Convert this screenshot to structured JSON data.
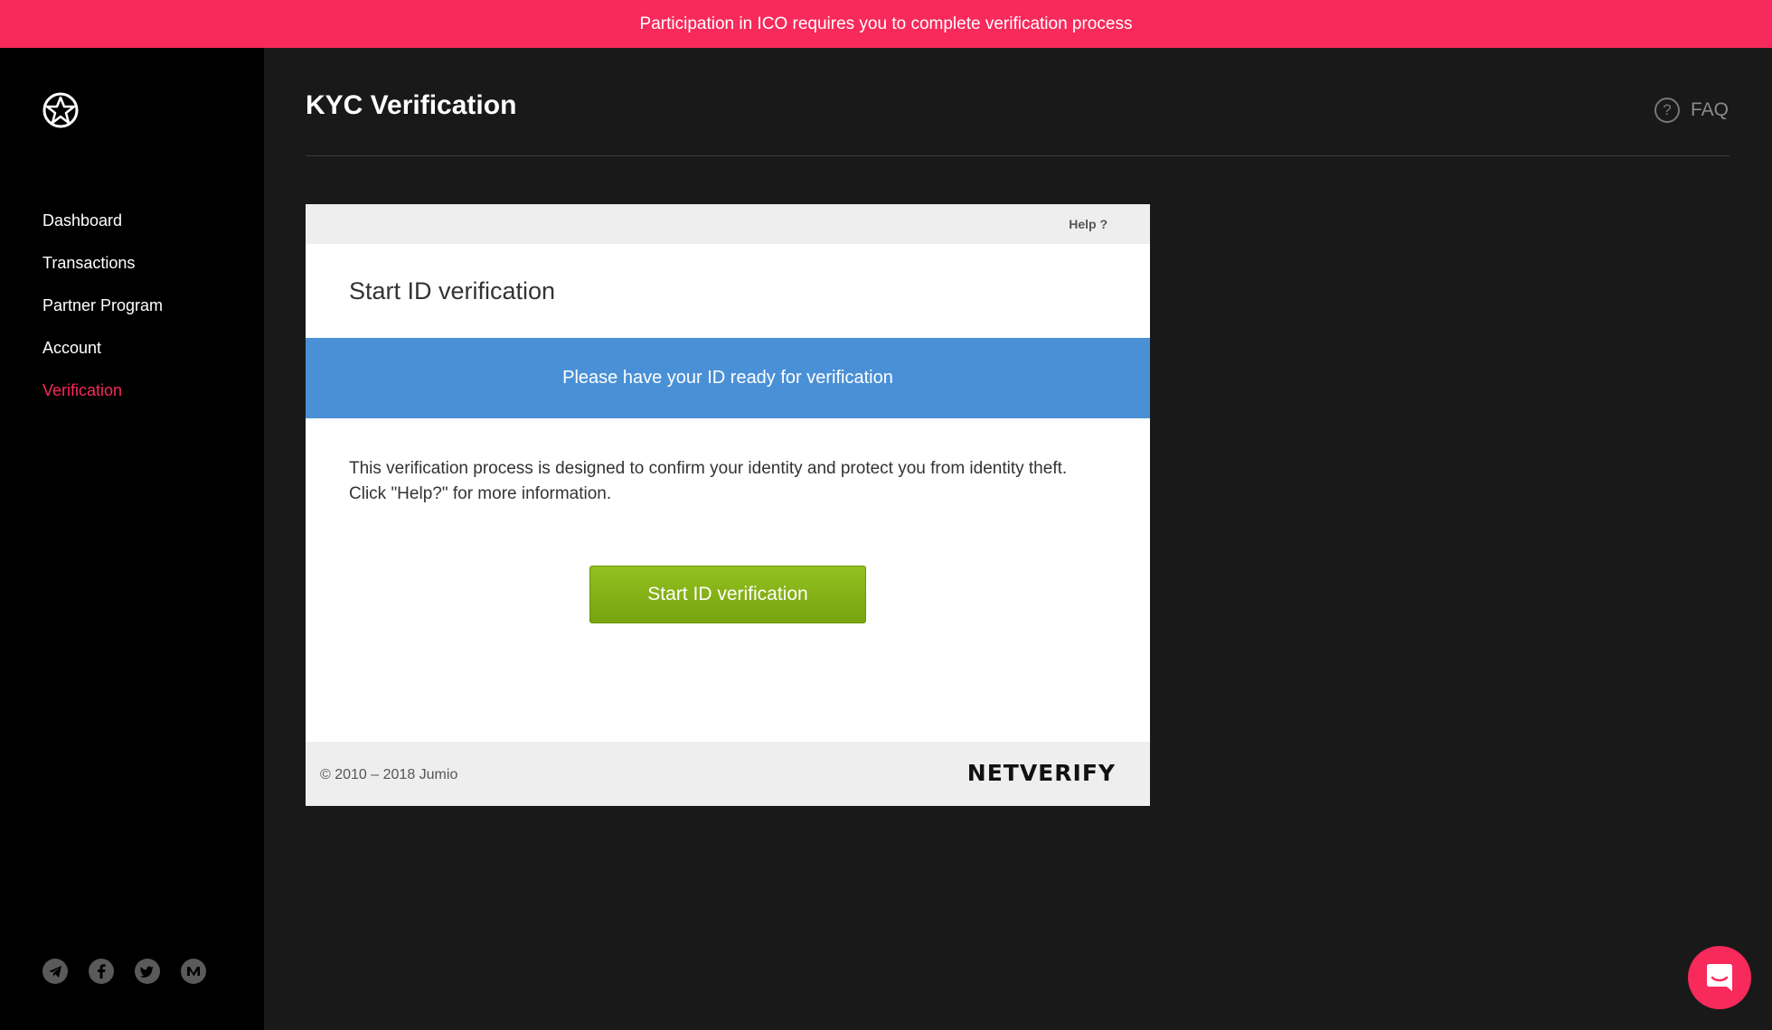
{
  "banner": {
    "text": "Participation in ICO requires you to complete verification process"
  },
  "sidebar": {
    "logo_icon": "star-badge-icon",
    "items": [
      {
        "label": "Dashboard"
      },
      {
        "label": "Transactions"
      },
      {
        "label": "Partner Program"
      },
      {
        "label": "Account"
      },
      {
        "label": "Verification",
        "active": true
      }
    ],
    "socials": [
      "telegram-icon",
      "facebook-icon",
      "twitter-icon",
      "medium-icon"
    ]
  },
  "header": {
    "title": "KYC Verification",
    "faq_icon": "?",
    "faq_label": "FAQ"
  },
  "panel": {
    "help_label": "Help ?",
    "heading": "Start ID verification",
    "info_bar": "Please have your ID ready for verification",
    "body_text": "This verification process is designed to confirm your identity and protect you from identity theft. Click \"Help?\" for more information.",
    "button_label": "Start ID verification",
    "copyright": "© 2010 – 2018 Jumio",
    "brand": "NETVERIFY"
  },
  "colors": {
    "accent": "#f8295b",
    "info_blue": "#4a90d6",
    "button_green": "#85b216"
  },
  "chat": {
    "icon": "chat-icon"
  }
}
